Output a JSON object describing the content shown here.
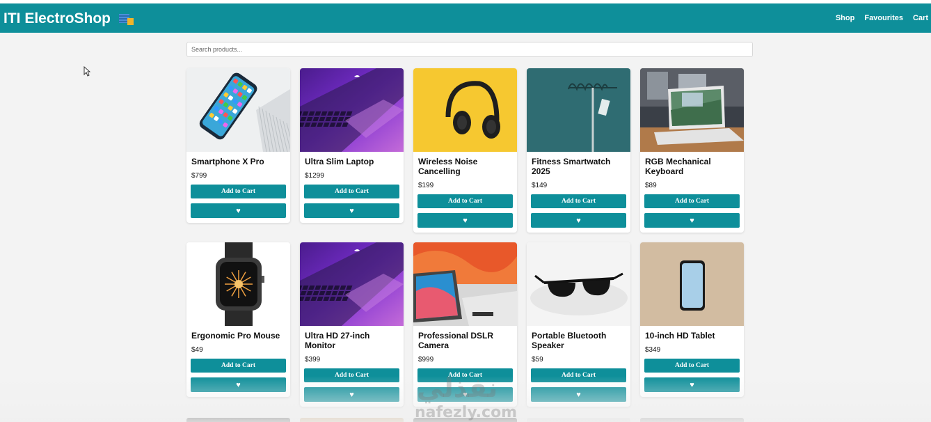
{
  "header": {
    "brand": "ITI ElectroShop",
    "brand_icon": "store-icon",
    "nav": [
      "Shop",
      "Favourites",
      "Cart"
    ]
  },
  "search": {
    "placeholder": "Search products..."
  },
  "colors": {
    "accent": "#0e8f9a",
    "background": "#f3f3f3"
  },
  "products": [
    {
      "name": "Smartphone X Pro",
      "price": "$799",
      "image": "phone-photo"
    },
    {
      "name": "Ultra Slim Laptop",
      "price": "$1299",
      "image": "laptop-purple-photo"
    },
    {
      "name": "Wireless Noise Cancelling",
      "price": "$199",
      "image": "headphones-photo"
    },
    {
      "name": "Fitness Smartwatch 2025",
      "price": "$149",
      "image": "stand-photo"
    },
    {
      "name": "RGB Mechanical Keyboard",
      "price": "$89",
      "image": "laptop-desk-photo"
    },
    {
      "name": "Ergonomic Pro Mouse",
      "price": "$49",
      "image": "smartwatch-photo"
    },
    {
      "name": "Ultra HD 27-inch Monitor",
      "price": "$399",
      "image": "laptop-purple-photo"
    },
    {
      "name": "Professional DSLR Camera",
      "price": "$999",
      "image": "macbook-photo"
    },
    {
      "name": "Portable Bluetooth Speaker",
      "price": "$59",
      "image": "sunglasses-photo"
    },
    {
      "name": "10-inch HD Tablet",
      "price": "$349",
      "image": "phone-wood-photo"
    }
  ],
  "buttons": {
    "add_to_cart": "Add to Cart",
    "favourite": "♥"
  },
  "watermark": "nafezly.com"
}
